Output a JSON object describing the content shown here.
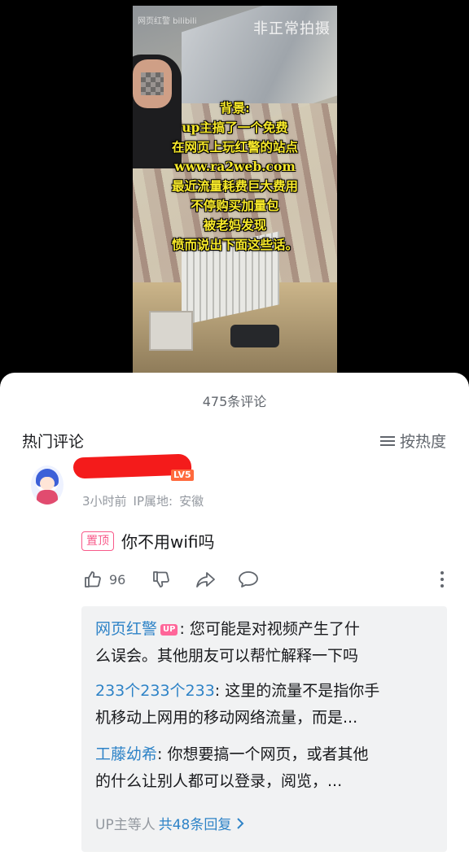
{
  "video": {
    "logo_text": "网页红警 bilibili",
    "watermark": "非正常拍摄",
    "caption_lines": [
      "背景:",
      "up主搞了一个免费",
      "在网页上玩红警的站点",
      "www.ra2web.com",
      "最近流量耗费巨大费用",
      "不停购买加量包",
      "被老妈发现",
      "愤而说出下面这些话。"
    ]
  },
  "comments_panel": {
    "title": "475条评论",
    "section_label": "热门评论",
    "sort_label": "按热度"
  },
  "top_comment": {
    "level": "LV5",
    "time": "3小时前",
    "ip_label": "IP属地:",
    "ip_location": "安徽",
    "pinned_tag": "置顶",
    "text": "你不用wifi吗",
    "like_count": "96"
  },
  "replies": [
    {
      "name": "网页红警",
      "up_badge": "UP",
      "line1": "您可能是对视频产生了什",
      "line2": "么误会。其他朋友可以帮忙解释一下吗"
    },
    {
      "name": "233个233个233",
      "line1": "这里的流量不是指你手",
      "line2": "机移动上网用的移动网络流量，而是..."
    },
    {
      "name": "工藤幼希",
      "line1": "你想要搞一个网页，或者其他",
      "line2": "的什么让别人都可以登录，阅览，..."
    }
  ],
  "reply_summary": {
    "prefix": "UP主等人",
    "link": "共48条回复"
  },
  "colors": {
    "accent_pink": "#f85a8a",
    "link_blue": "#2e83c7",
    "caption_yellow": "#f8ea2a",
    "redaction_red": "#f41b1b"
  },
  "icons": [
    "like-icon",
    "dislike-icon",
    "share-icon",
    "comment-icon",
    "more-icon",
    "sort-icon",
    "chevron-right-icon"
  ]
}
